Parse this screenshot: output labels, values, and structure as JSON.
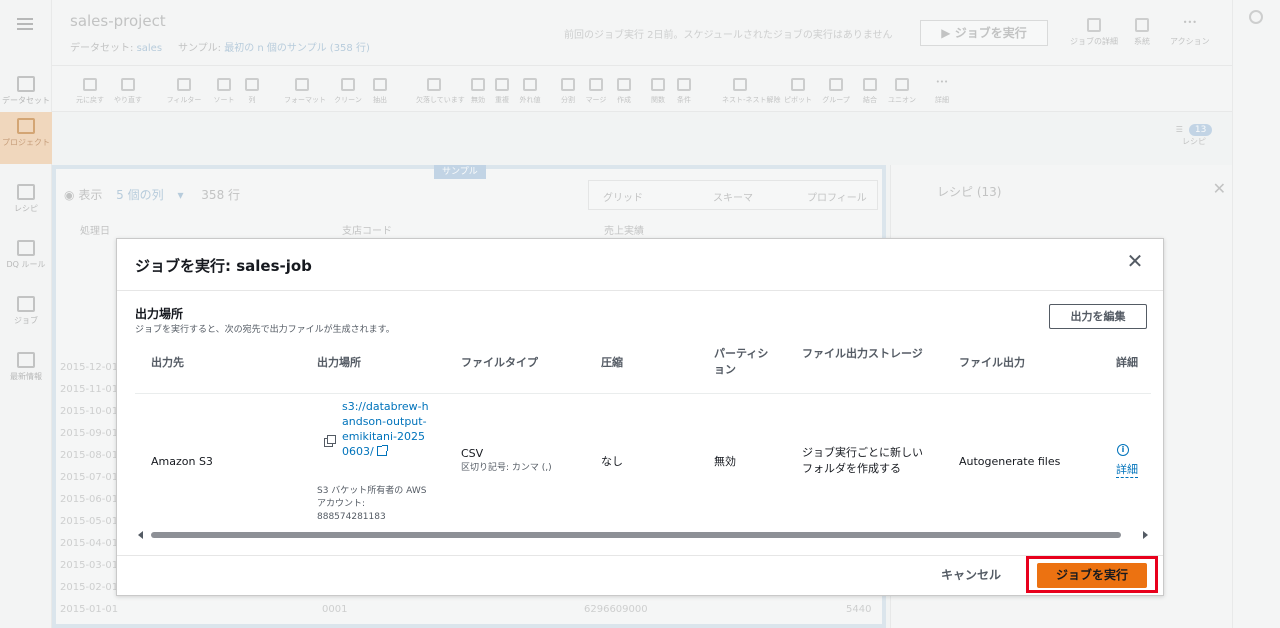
{
  "app": {
    "project_title": "sales-project",
    "dataset_label": "データセット:",
    "dataset_value": "sales",
    "sample_label": "サンプル:",
    "sample_value": "最初の n 個のサンプル (358 行)",
    "status_text": "前回のジョブ実行 2日前。スケジュールされたジョブの実行はありません",
    "run_job_label": "ジョブを実行",
    "top_actions": [
      "ジョブの詳細",
      "系統",
      "アクション"
    ],
    "rail_items": [
      "データセット",
      "プロジェクト",
      "レシピ",
      "DQ ルール",
      "ジョブ",
      "最新情報"
    ],
    "toolbar": [
      "元に戻す",
      "やり直す",
      "フィルター",
      "ソート",
      "列",
      "フォーマット",
      "クリーン",
      "抽出",
      "欠落しています",
      "無効",
      "重複",
      "外れ値",
      "分割",
      "マージ",
      "作成",
      "関数",
      "条件",
      "ネスト-ネスト解除",
      "ピボット",
      "グループ",
      "結合",
      "ユニオン",
      "詳細"
    ],
    "recipe_label": "レシピ",
    "recipe_count": "13",
    "sample_tag": "サンプル",
    "grid_view": "表示",
    "grid_columns": "5 個の列",
    "grid_rows": "358 行",
    "grid_tabs": [
      "グリッド",
      "スキーマ",
      "プロフィール"
    ],
    "grid_columns_headers": [
      "処理日",
      "支店コード",
      "売上実績"
    ],
    "grid_dates": [
      "2015-12-01",
      "2015-11-01",
      "2015-10-01",
      "2015-09-01",
      "2015-08-01",
      "2015-07-01",
      "2015-06-01",
      "2015-05-01",
      "2015-04-01",
      "2015-03-01",
      "2015-02-01",
      "2015-01-01"
    ],
    "grid_last_row": [
      "0001",
      "6296609000",
      "5440"
    ],
    "recipe_panel_title": "レシピ (13)"
  },
  "modal": {
    "title": "ジョブを実行: sales-job",
    "section_title": "出力場所",
    "section_desc": "ジョブを実行すると、次の宛先で出力ファイルが生成されます。",
    "edit_button": "出力を編集",
    "columns": [
      "出力先",
      "出力場所",
      "ファイルタイプ",
      "圧縮",
      "パーティション",
      "ファイル出力ストレージ",
      "ファイル出力",
      "詳細"
    ],
    "row": {
      "destination": "Amazon S3",
      "location_link": "s3://databrew-handson-output-emikitani-20250603/",
      "owner_label": "S3 バケット所有者の AWS アカウント:",
      "owner_account": "888574281183",
      "file_type": "CSV",
      "delimiter": "区切り記号: カンマ (,)",
      "compression": "なし",
      "partition": "無効",
      "storage": "ジョブ実行ごとに新しいフォルダを作成する",
      "file_output": "Autogenerate files",
      "details_link": "詳細"
    },
    "cancel_button": "キャンセル",
    "run_button": "ジョブを実行",
    "accent_color": "#ec7211",
    "highlight_color": "#e8001c"
  }
}
